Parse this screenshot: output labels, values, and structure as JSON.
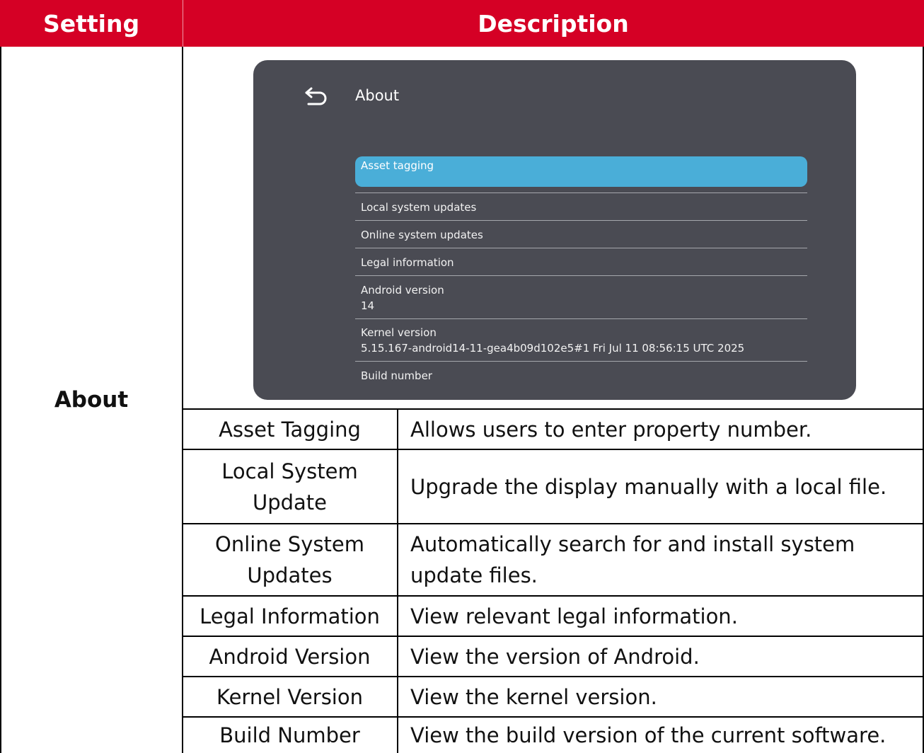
{
  "header": {
    "setting": "Setting",
    "description": "Description"
  },
  "setting_label": "About",
  "screen": {
    "title": "About",
    "selected_item": "Asset tagging",
    "items": [
      {
        "label": "Local system updates",
        "value": ""
      },
      {
        "label": "Online system updates",
        "value": ""
      },
      {
        "label": "Legal information",
        "value": ""
      },
      {
        "label": "Android version",
        "value": "14"
      },
      {
        "label": "Kernel version",
        "value": "5.15.167-android14-11-gea4b09d102e5#1 Fri Jul 11 08:56:15 UTC 2025"
      },
      {
        "label": "Build number",
        "value": ""
      }
    ]
  },
  "rows": [
    {
      "name": "Asset Tagging",
      "description": "Allows users to enter property number."
    },
    {
      "name": "Local System Update",
      "description": "Upgrade the display manually with a local file."
    },
    {
      "name": "Online System Updates",
      "description": "Automatically search for and install system update files."
    },
    {
      "name": "Legal Information",
      "description": "View relevant legal information."
    },
    {
      "name": "Android Version",
      "description": "View the version of Android."
    },
    {
      "name": "Kernel Version",
      "description": "View the kernel version."
    },
    {
      "name": "Build Number",
      "description": "View the build version of the current software."
    }
  ],
  "colors": {
    "header_bg": "#d50025",
    "screen_bg": "#4a4b53",
    "highlight": "#4aaed8"
  }
}
